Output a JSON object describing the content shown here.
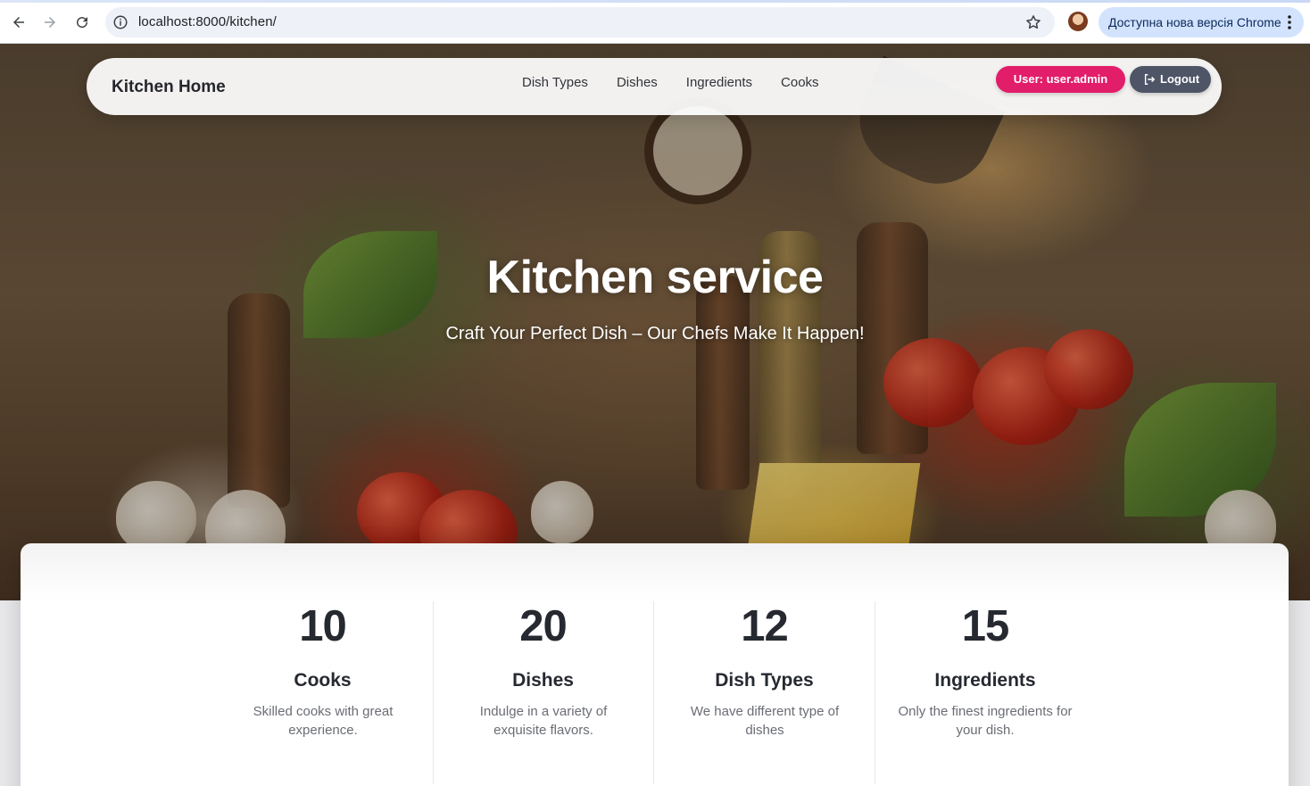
{
  "browser": {
    "url": "localhost:8000/kitchen/",
    "update_label": "Доступна нова версія Chrome"
  },
  "site_nav": {
    "brand": "Kitchen Home",
    "links": [
      "Dish Types",
      "Dishes",
      "Ingredients",
      "Cooks"
    ],
    "user_button": "User: user.admin",
    "logout_button": "Logout"
  },
  "hero": {
    "title": "Kitchen service",
    "subtitle": "Craft Your Perfect Dish – Our Chefs Make It Happen!"
  },
  "stats": [
    {
      "number": "10",
      "title": "Cooks",
      "text": "Skilled cooks with great experience."
    },
    {
      "number": "20",
      "title": "Dishes",
      "text": "Indulge in a variety of exquisite flavors."
    },
    {
      "number": "12",
      "title": "Dish Types",
      "text": "We have different type of dishes"
    },
    {
      "number": "15",
      "title": "Ingredients",
      "text": "Only the finest ingredients for your dish."
    }
  ],
  "colors": {
    "user_button": "#e21d6a",
    "logout_button": "#4e5566",
    "update_pill": "#d3e3fd"
  }
}
